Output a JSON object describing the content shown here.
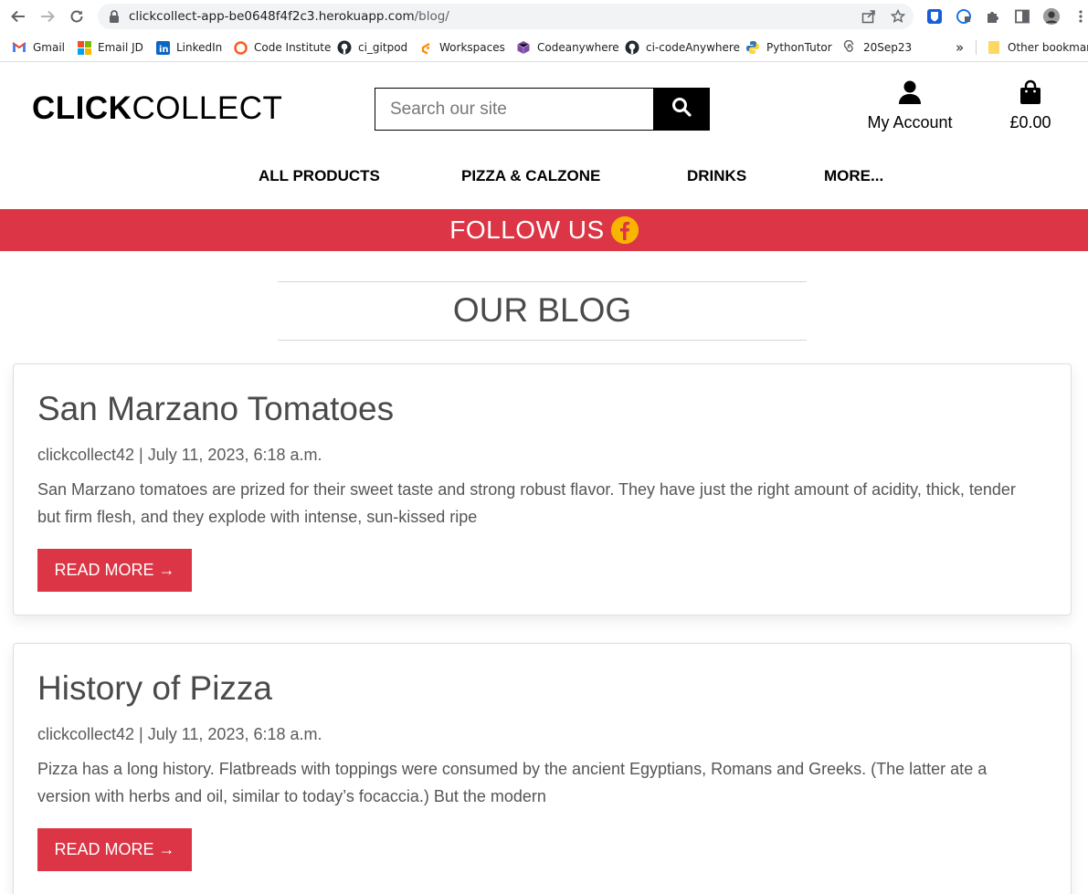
{
  "browser": {
    "url_host": "clickcollect-app-be0648f4f2c3.herokuapp.com",
    "url_path": "/blog/"
  },
  "bookmarks": [
    {
      "label": "Gmail",
      "icon": "gmail-icon"
    },
    {
      "label": "Email JD",
      "icon": "microsoft-icon"
    },
    {
      "label": "LinkedIn",
      "icon": "linkedin-icon"
    },
    {
      "label": "Code Institute",
      "icon": "code-institute-icon"
    },
    {
      "label": "ci_gitpod",
      "icon": "github-icon"
    },
    {
      "label": "Workspaces",
      "icon": "gitpod-icon"
    },
    {
      "label": "Codeanywhere",
      "icon": "cube-icon"
    },
    {
      "label": "ci-codeAnywhere",
      "icon": "github-icon"
    },
    {
      "label": "PythonTutor",
      "icon": "python-icon"
    },
    {
      "label": "20Sep23",
      "icon": "spiral-icon"
    }
  ],
  "bookmarks_overflow": "»",
  "other_bookmarks": "Other bookmarks",
  "site": {
    "logo_bold": "CLICK",
    "logo_light": "COLLECT",
    "search_placeholder": "Search our site",
    "account_label": "My Account",
    "bag_total": "£0.00",
    "nav": [
      "ALL PRODUCTS",
      "PIZZA & CALZONE",
      "DRINKS",
      "MORE..."
    ],
    "banner_text": "FOLLOW US",
    "page_heading": "OUR BLOG"
  },
  "posts": [
    {
      "title": "San Marzano Tomatoes",
      "meta": "clickcollect42 | July 11, 2023, 6:18 a.m.",
      "excerpt": "San Marzano tomatoes are prized for their sweet taste and strong robust flavor. They have just the right amount of acidity, thick, tender but firm flesh, and they explode with intense, sun-kissed ripe",
      "button": "READ MORE →"
    },
    {
      "title": "History of Pizza",
      "meta": "clickcollect42 | July 11, 2023, 6:18 a.m.",
      "excerpt": "Pizza has a long history. Flatbreads with toppings were consumed by the ancient Egyptians, Romans and Greeks. (The latter ate a version with herbs and oil, similar to today’s focaccia.) But the modern",
      "button": "READ MORE →"
    }
  ],
  "colors": {
    "accent_red": "#dc3545",
    "facebook_yellow": "#f7b500"
  }
}
